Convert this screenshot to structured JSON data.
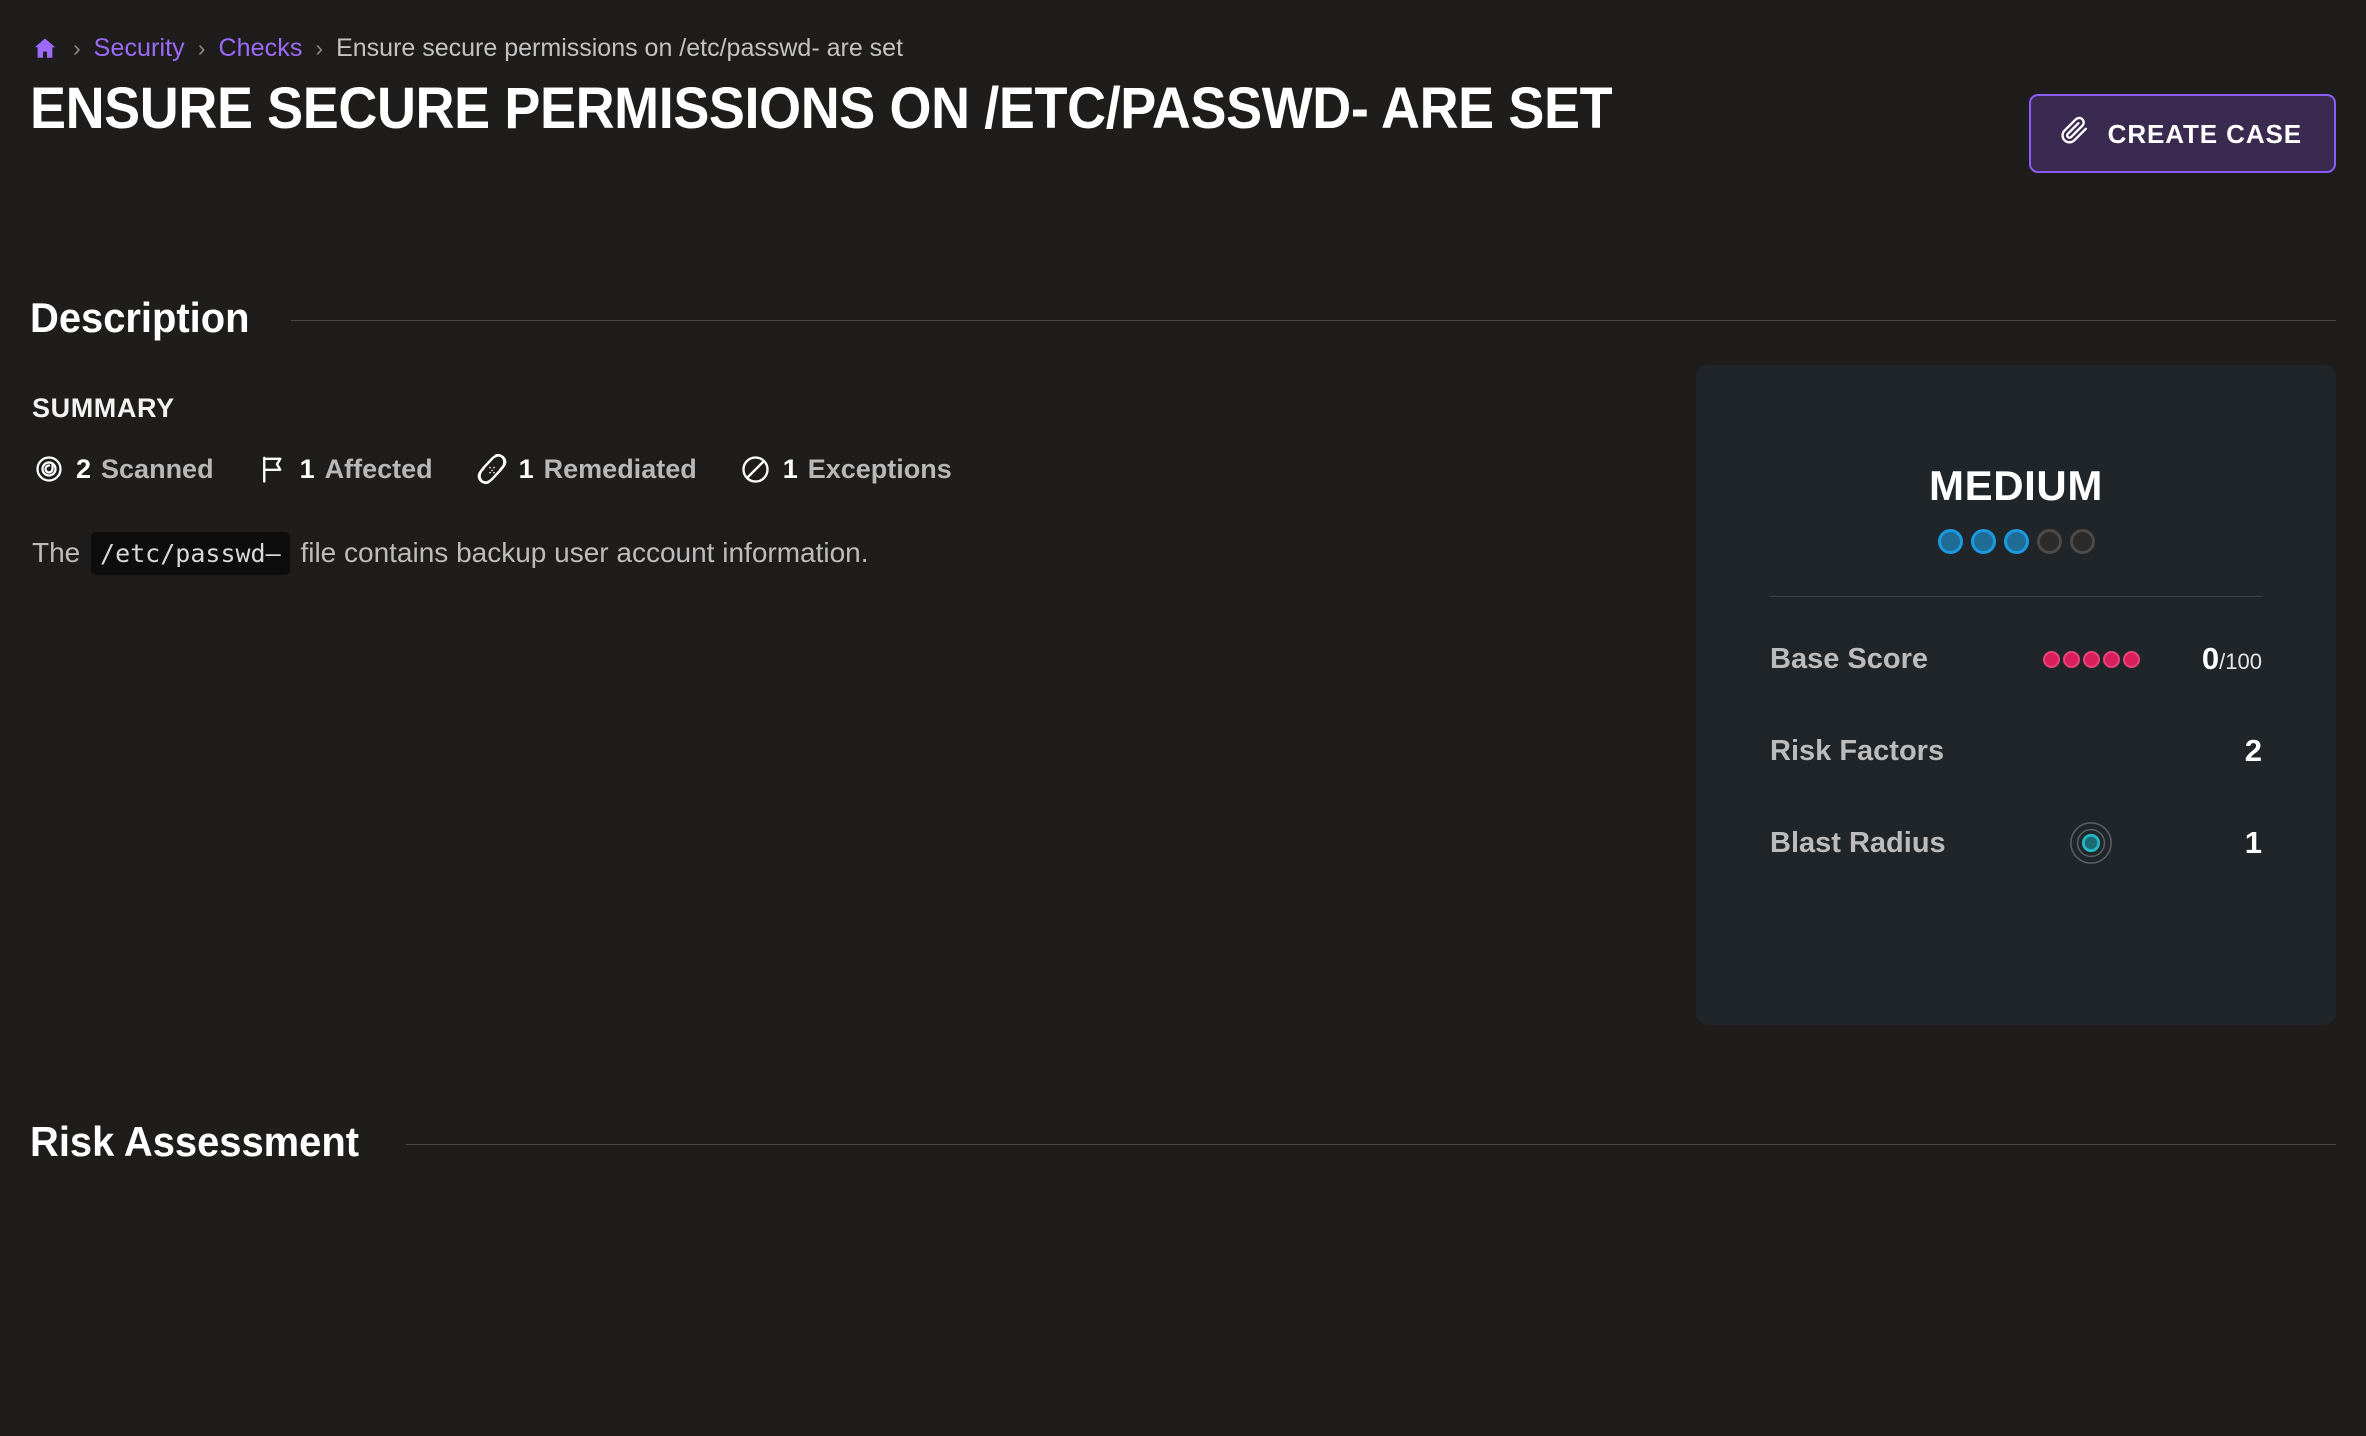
{
  "breadcrumb": {
    "home_icon": "home-icon",
    "separator": "›",
    "items": [
      {
        "label": "Security",
        "type": "link"
      },
      {
        "label": "Checks",
        "type": "link"
      },
      {
        "label": "Ensure secure permissions on /etc/passwd- are set",
        "type": "current"
      }
    ]
  },
  "header": {
    "title": "ENSURE SECURE PERMISSIONS ON /ETC/PASSWD- ARE SET",
    "create_case_label": "CREATE CASE",
    "create_case_icon": "paperclip-icon",
    "accent_color": "#8b5cf6",
    "button_bg": "#3a2a50"
  },
  "description_section": {
    "heading": "Description",
    "summary_label": "SUMMARY",
    "stats": [
      {
        "icon": "target-icon",
        "count": "2",
        "label": "Scanned"
      },
      {
        "icon": "flag-icon",
        "count": "1",
        "label": "Affected"
      },
      {
        "icon": "bandage-icon",
        "count": "1",
        "label": "Remediated"
      },
      {
        "icon": "ban-icon",
        "count": "1",
        "label": "Exceptions"
      }
    ],
    "body_prefix": "The",
    "body_code": "/etc/passwd–",
    "body_suffix": "file contains backup user account information."
  },
  "severity_card": {
    "level": "MEDIUM",
    "level_dots_total": 5,
    "level_dots_filled": 3,
    "dot_on_color": "#1b9ae0",
    "dot_off_color": "#4d4a48",
    "rows": [
      {
        "label": "Base Score",
        "mid_type": "score-dots",
        "score_dots": 5,
        "score_dot_color": "#d81e5b",
        "value": "0",
        "denominator": "/100"
      },
      {
        "label": "Risk Factors",
        "mid_type": "none",
        "value": "2",
        "denominator": ""
      },
      {
        "label": "Blast Radius",
        "mid_type": "blast-icon",
        "blast_icon": "blast-radius-icon",
        "blast_color": "#25b5c4",
        "value": "1",
        "denominator": ""
      }
    ]
  },
  "risk_section": {
    "heading": "Risk Assessment"
  }
}
